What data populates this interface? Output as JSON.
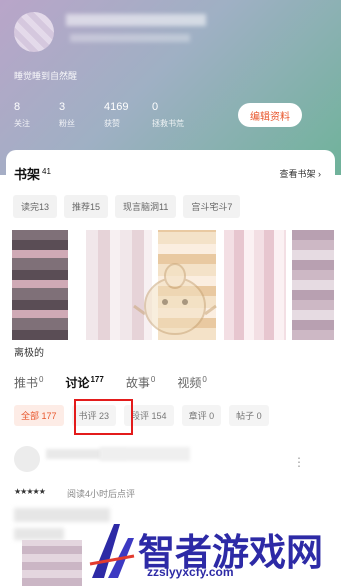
{
  "profile": {
    "bio": "睡觉睡到自然醒",
    "stats": [
      {
        "value": "8",
        "label": "关注"
      },
      {
        "value": "3",
        "label": "粉丝"
      },
      {
        "value": "4169",
        "label": "获赞"
      },
      {
        "value": "0",
        "label": "拯救书荒"
      }
    ],
    "edit_label": "编辑资料"
  },
  "shelf": {
    "title": "书架",
    "count": "41",
    "more_label": "查看书架",
    "tabs": [
      "读完13",
      "推荐15",
      "现言脑洞11",
      "宫斗宅斗7"
    ],
    "first_cover_title": "离极的"
  },
  "main_tabs": [
    {
      "label": "推书",
      "count": "0"
    },
    {
      "label": "讨论",
      "count": "177"
    },
    {
      "label": "故事",
      "count": "0"
    },
    {
      "label": "视频",
      "count": "0"
    }
  ],
  "filters": [
    "全部 177",
    "书评 23",
    "段评 154",
    "章评 0",
    "帖子 0"
  ],
  "post": {
    "stars": "★★★★★",
    "meta": "阅读4小时后点评"
  },
  "watermark": {
    "text": "智者游戏网",
    "url": "zzslyyxcfy.com"
  },
  "colors": {
    "accent": "#e8562c",
    "highlight_box": "#e31b1b",
    "watermark": "#2d2aa6"
  }
}
